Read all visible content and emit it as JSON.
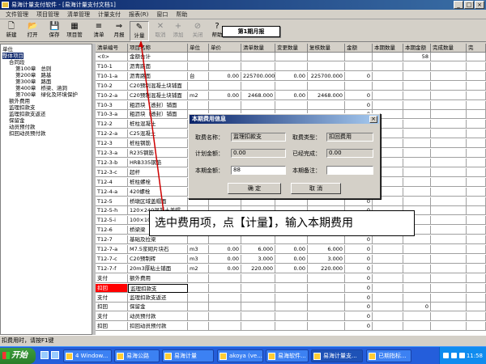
{
  "window": {
    "title": "易海计量支付软件 - [易海计量支付文档1]",
    "min": "_",
    "max": "□",
    "close": "×"
  },
  "menu": [
    "文件管理",
    "项目管理",
    "清单管理",
    "计量支付",
    "报表(R)",
    "窗口",
    "帮助"
  ],
  "toolbar": [
    {
      "label": "新建",
      "icon": "new-file-icon",
      "glyph": "🗋",
      "enabled": true
    },
    {
      "label": "打开",
      "icon": "folder-open-icon",
      "glyph": "📂",
      "enabled": true
    },
    {
      "label": "保存",
      "icon": "save-icon",
      "glyph": "💾",
      "enabled": true
    },
    {
      "label": "项目管",
      "icon": "project-icon",
      "glyph": "▦",
      "enabled": true
    },
    {
      "label": "清单",
      "icon": "list-icon",
      "glyph": "≡",
      "enabled": true
    },
    {
      "label": "月报",
      "icon": "report-icon",
      "glyph": "⇒",
      "enabled": true
    },
    {
      "label": "计量",
      "icon": "measure-icon",
      "glyph": "✎",
      "enabled": true
    },
    {
      "label": "取消",
      "icon": "cancel-icon",
      "glyph": "✕",
      "enabled": false
    },
    {
      "label": "添加",
      "icon": "add-icon",
      "glyph": "+",
      "enabled": false
    },
    {
      "label": "关闭",
      "icon": "close-doc-icon",
      "glyph": "⊘",
      "enabled": false
    },
    {
      "label": "帮助",
      "icon": "help-icon",
      "glyph": "?",
      "enabled": true
    }
  ],
  "period_label": "第1期月报",
  "tree": {
    "rows": [
      {
        "text": "单位",
        "indent": 0,
        "selected": false
      },
      {
        "text": "整体项目",
        "indent": 0,
        "selected": true
      },
      {
        "text": "合同段",
        "indent": 1,
        "selected": false
      },
      {
        "text": "第100章",
        "extra": "总则",
        "indent": 2,
        "selected": false
      },
      {
        "text": "第200章",
        "extra": "路基",
        "indent": 2,
        "selected": false
      },
      {
        "text": "第300章",
        "extra": "路面",
        "indent": 2,
        "selected": false
      },
      {
        "text": "第400章",
        "extra": "桥梁、涵洞",
        "indent": 2,
        "selected": false
      },
      {
        "text": "第700章",
        "extra": "绿化及环境保护",
        "indent": 2,
        "selected": false
      },
      {
        "text": "额外费用",
        "indent": 1,
        "selected": false
      },
      {
        "text": "监理扣款支",
        "indent": 1,
        "selected": false
      },
      {
        "text": "监理扣款支返还",
        "indent": 1,
        "selected": false
      },
      {
        "text": "保留金",
        "indent": 1,
        "selected": false
      },
      {
        "text": "动员预付款",
        "indent": 1,
        "selected": false
      },
      {
        "text": "扣回动员预付款",
        "indent": 1,
        "selected": false
      }
    ]
  },
  "grid": {
    "headers": [
      "清单编号",
      "项目名称",
      "单位",
      "单价",
      "清单数量",
      "变更数量",
      "复核数量",
      "金额",
      "本期数量",
      "本期金额",
      "完成数量",
      "完"
    ],
    "rows": [
      [
        "<0>",
        "金额合计",
        "",
        "",
        "",
        "",
        "",
        "",
        "",
        "58",
        "",
        ""
      ],
      [
        "T10-1",
        "沥青路面",
        "",
        "",
        "",
        "",
        "",
        "",
        "",
        "",
        "",
        ""
      ],
      [
        "T10-1-a",
        "沥青路面",
        "台",
        "0.00",
        "225700.000",
        "0.00",
        "225700.000",
        "0",
        "",
        "",
        "",
        ""
      ],
      [
        "T10-2",
        "C20预制混凝土块铺面",
        "",
        "",
        "",
        "",
        "",
        "",
        "",
        "",
        "",
        ""
      ],
      [
        "T10-2-a",
        "C20预制混凝土块铺面",
        "m2",
        "0.00",
        "2468.000",
        "0.00",
        "2468.000",
        "0",
        "",
        "",
        "",
        ""
      ],
      [
        "T10-3",
        "粗沥块（透封）铺面",
        "",
        "",
        "",
        "",
        "",
        "0",
        "",
        "",
        "",
        ""
      ],
      [
        "T10-3-a",
        "粗沥块（透封）铺面",
        "",
        "",
        "",
        "",
        "",
        "0",
        "",
        "",
        "",
        ""
      ],
      [
        "T12-2",
        "桩柱混凝土",
        "",
        "",
        "",
        "",
        "",
        "0",
        "",
        "",
        "",
        ""
      ],
      [
        "T12-2-a",
        "C25混凝土",
        "",
        "",
        "",
        "",
        "",
        "0",
        "",
        "",
        "",
        ""
      ],
      [
        "T12-3",
        "桩柱钢筋",
        "",
        "",
        "",
        "",
        "",
        "0",
        "",
        "",
        "",
        ""
      ],
      [
        "T12-3-a",
        "R235钢筋",
        "",
        "",
        "",
        "",
        "",
        "0",
        "",
        "",
        "",
        ""
      ],
      [
        "T12-3-b",
        "HRB335钢筋",
        "",
        "",
        "",
        "",
        "",
        "0",
        "",
        "",
        "",
        ""
      ],
      [
        "T12-3-c",
        "超杆",
        "",
        "",
        "",
        "",
        "",
        "0",
        "",
        "",
        "",
        ""
      ],
      [
        "T12-4",
        "桩柱螺栓",
        "",
        "",
        "",
        "",
        "",
        "0",
        "",
        "",
        "",
        ""
      ],
      [
        "T12-4-a",
        "420螺栓",
        "",
        "",
        "",
        "",
        "",
        "0",
        "",
        "",
        "",
        ""
      ],
      [
        "T12-5",
        "桥墩区域盖帽面",
        "",
        "",
        "",
        "",
        "",
        "0",
        "",
        "",
        "",
        ""
      ],
      [
        "T12-5-h",
        "120×240混凝土盖帽",
        "",
        "",
        "",
        "",
        "",
        "0",
        "",
        "",
        "",
        ""
      ],
      [
        "T12-5-i",
        "100×100混凝土盖帽",
        "",
        "",
        "",
        "",
        "",
        "0",
        "",
        "",
        "",
        ""
      ],
      [
        "T12-6",
        "桥梁梁",
        "",
        "",
        "",
        "",
        "",
        "0",
        "",
        "",
        "",
        ""
      ],
      [
        "T12-7",
        "基础及拉梁",
        "",
        "",
        "",
        "",
        "",
        "0",
        "",
        "",
        "",
        ""
      ],
      [
        "T12-7-a",
        "M7.5浆砌片块石",
        "m3",
        "0.00",
        "6.000",
        "0.00",
        "6.000",
        "0",
        "",
        "",
        "",
        ""
      ],
      [
        "T12-7-c",
        "C20预制砖",
        "m3",
        "0.00",
        "3.000",
        "0.00",
        "3.000",
        "0",
        "",
        "",
        "",
        ""
      ],
      [
        "T12-7-f",
        "20m3厚粘土铺面",
        "m2",
        "0.00",
        "220.000",
        "0.00",
        "220.000",
        "0",
        "",
        "",
        "",
        ""
      ],
      [
        "支付",
        "额外费用",
        "",
        "",
        "",
        "",
        "",
        "0",
        "",
        "",
        "",
        ""
      ],
      [
        "扣回",
        "监理扣款支",
        "",
        "",
        "",
        "",
        "",
        "0",
        "",
        "",
        "",
        ""
      ],
      [
        "支付",
        "监理扣款支返还",
        "",
        "",
        "",
        "",
        "",
        "0",
        "",
        "",
        "",
        ""
      ],
      [
        "扣回",
        "保留金",
        "",
        "",
        "",
        "",
        "",
        "0",
        "",
        "0",
        "",
        ""
      ],
      [
        "支付",
        "动员预付款",
        "",
        "",
        "",
        "",
        "",
        "0",
        "",
        "",
        "",
        ""
      ],
      [
        "扣回",
        "扣回动员预付款",
        "",
        "",
        "",
        "",
        "",
        "0",
        "",
        "",
        "",
        ""
      ]
    ]
  },
  "dialog": {
    "title": "本期费用信息",
    "name_label": "取费名称：",
    "name_value": "监理扣款支",
    "type_label": "取费类型：",
    "type_value": "扣回费用",
    "plan_label": "计划金额：",
    "plan_value": "0.00",
    "done_label": "已经完成：",
    "done_value": "0.00",
    "current_label": "本期金额：",
    "current_value": "88",
    "note_label": "本期备注：",
    "note_value": "",
    "ok": "确  定",
    "cancel": "取  消",
    "close": "×"
  },
  "callout": "选中费用项，点【计量】，输入本期费用",
  "status": "扣费用时，请按F1键",
  "taskbar": {
    "start": "开始",
    "tasks": [
      "4 Window...",
      "易海公路",
      "易海计量",
      "akoya (ve...",
      "易海软件...",
      "易海计量支...",
      "已期指标..."
    ],
    "clock": "11:58"
  }
}
